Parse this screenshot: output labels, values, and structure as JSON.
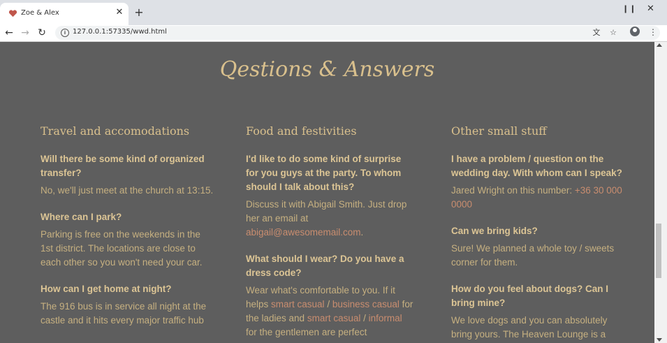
{
  "browser": {
    "tab_title": "Zoe & Alex",
    "tab_close": "✕",
    "new_tab": "+",
    "url": "127.0.0.1:57335/wwd.html",
    "win_minimize": "❙❙",
    "win_close": "✕"
  },
  "section": {
    "heading": "Qestions & Answers",
    "columns": [
      {
        "title": "Travel and accomodations",
        "items": [
          {
            "q": "Will there be some kind of organized transfer?",
            "a": "No, we'll just meet at the church at 13:15."
          },
          {
            "q": "Where can I park?",
            "a": "Parking is free on the weekends in the 1st district. The locations are close to each other so you won't need your car."
          },
          {
            "q": "How can I get home at night?",
            "a": "The 916 bus is in service all night at the castle and it hits every major traffic hub"
          }
        ]
      },
      {
        "title": "Food and festivities",
        "items": [
          {
            "q": "I'd like to do some kind of surprise for you guys at the party. To whom should I talk about this?",
            "a_pre": "Discuss it with Abigail Smith. Just drop her an email at ",
            "a_link": "abigail@awesomemail.com",
            "a_post": "."
          },
          {
            "q": "What should I wear? Do you have a dress code?",
            "a_1": "Wear what's comfortable to you. If it helps ",
            "link_1": "smart casual",
            "sep_1": " / ",
            "link_2": "business casual",
            "a_2": " for the ladies and ",
            "link_3": "smart casual",
            "sep_2": " / ",
            "link_4": "informal",
            "a_3": " for the gentlemen are perfect"
          }
        ]
      },
      {
        "title": "Other small stuff",
        "items": [
          {
            "q": "I have a problem / question on the wedding day. With whom can I speak?",
            "a_pre": "Jared Wright on this number: ",
            "a_link": "+36 30 000 0000"
          },
          {
            "q": "Can we bring kids?",
            "a": "Sure! We planned a whole toy / sweets corner for them."
          },
          {
            "q": "How do you feel about dogs? Can I bring mine?",
            "a": "We love dogs and you can absolutely bring yours. The Heaven Lounge is a"
          }
        ]
      }
    ]
  },
  "colors": {
    "background": "#5e5e5e",
    "gold": "#d9c08d",
    "link": "#c98d6f"
  }
}
